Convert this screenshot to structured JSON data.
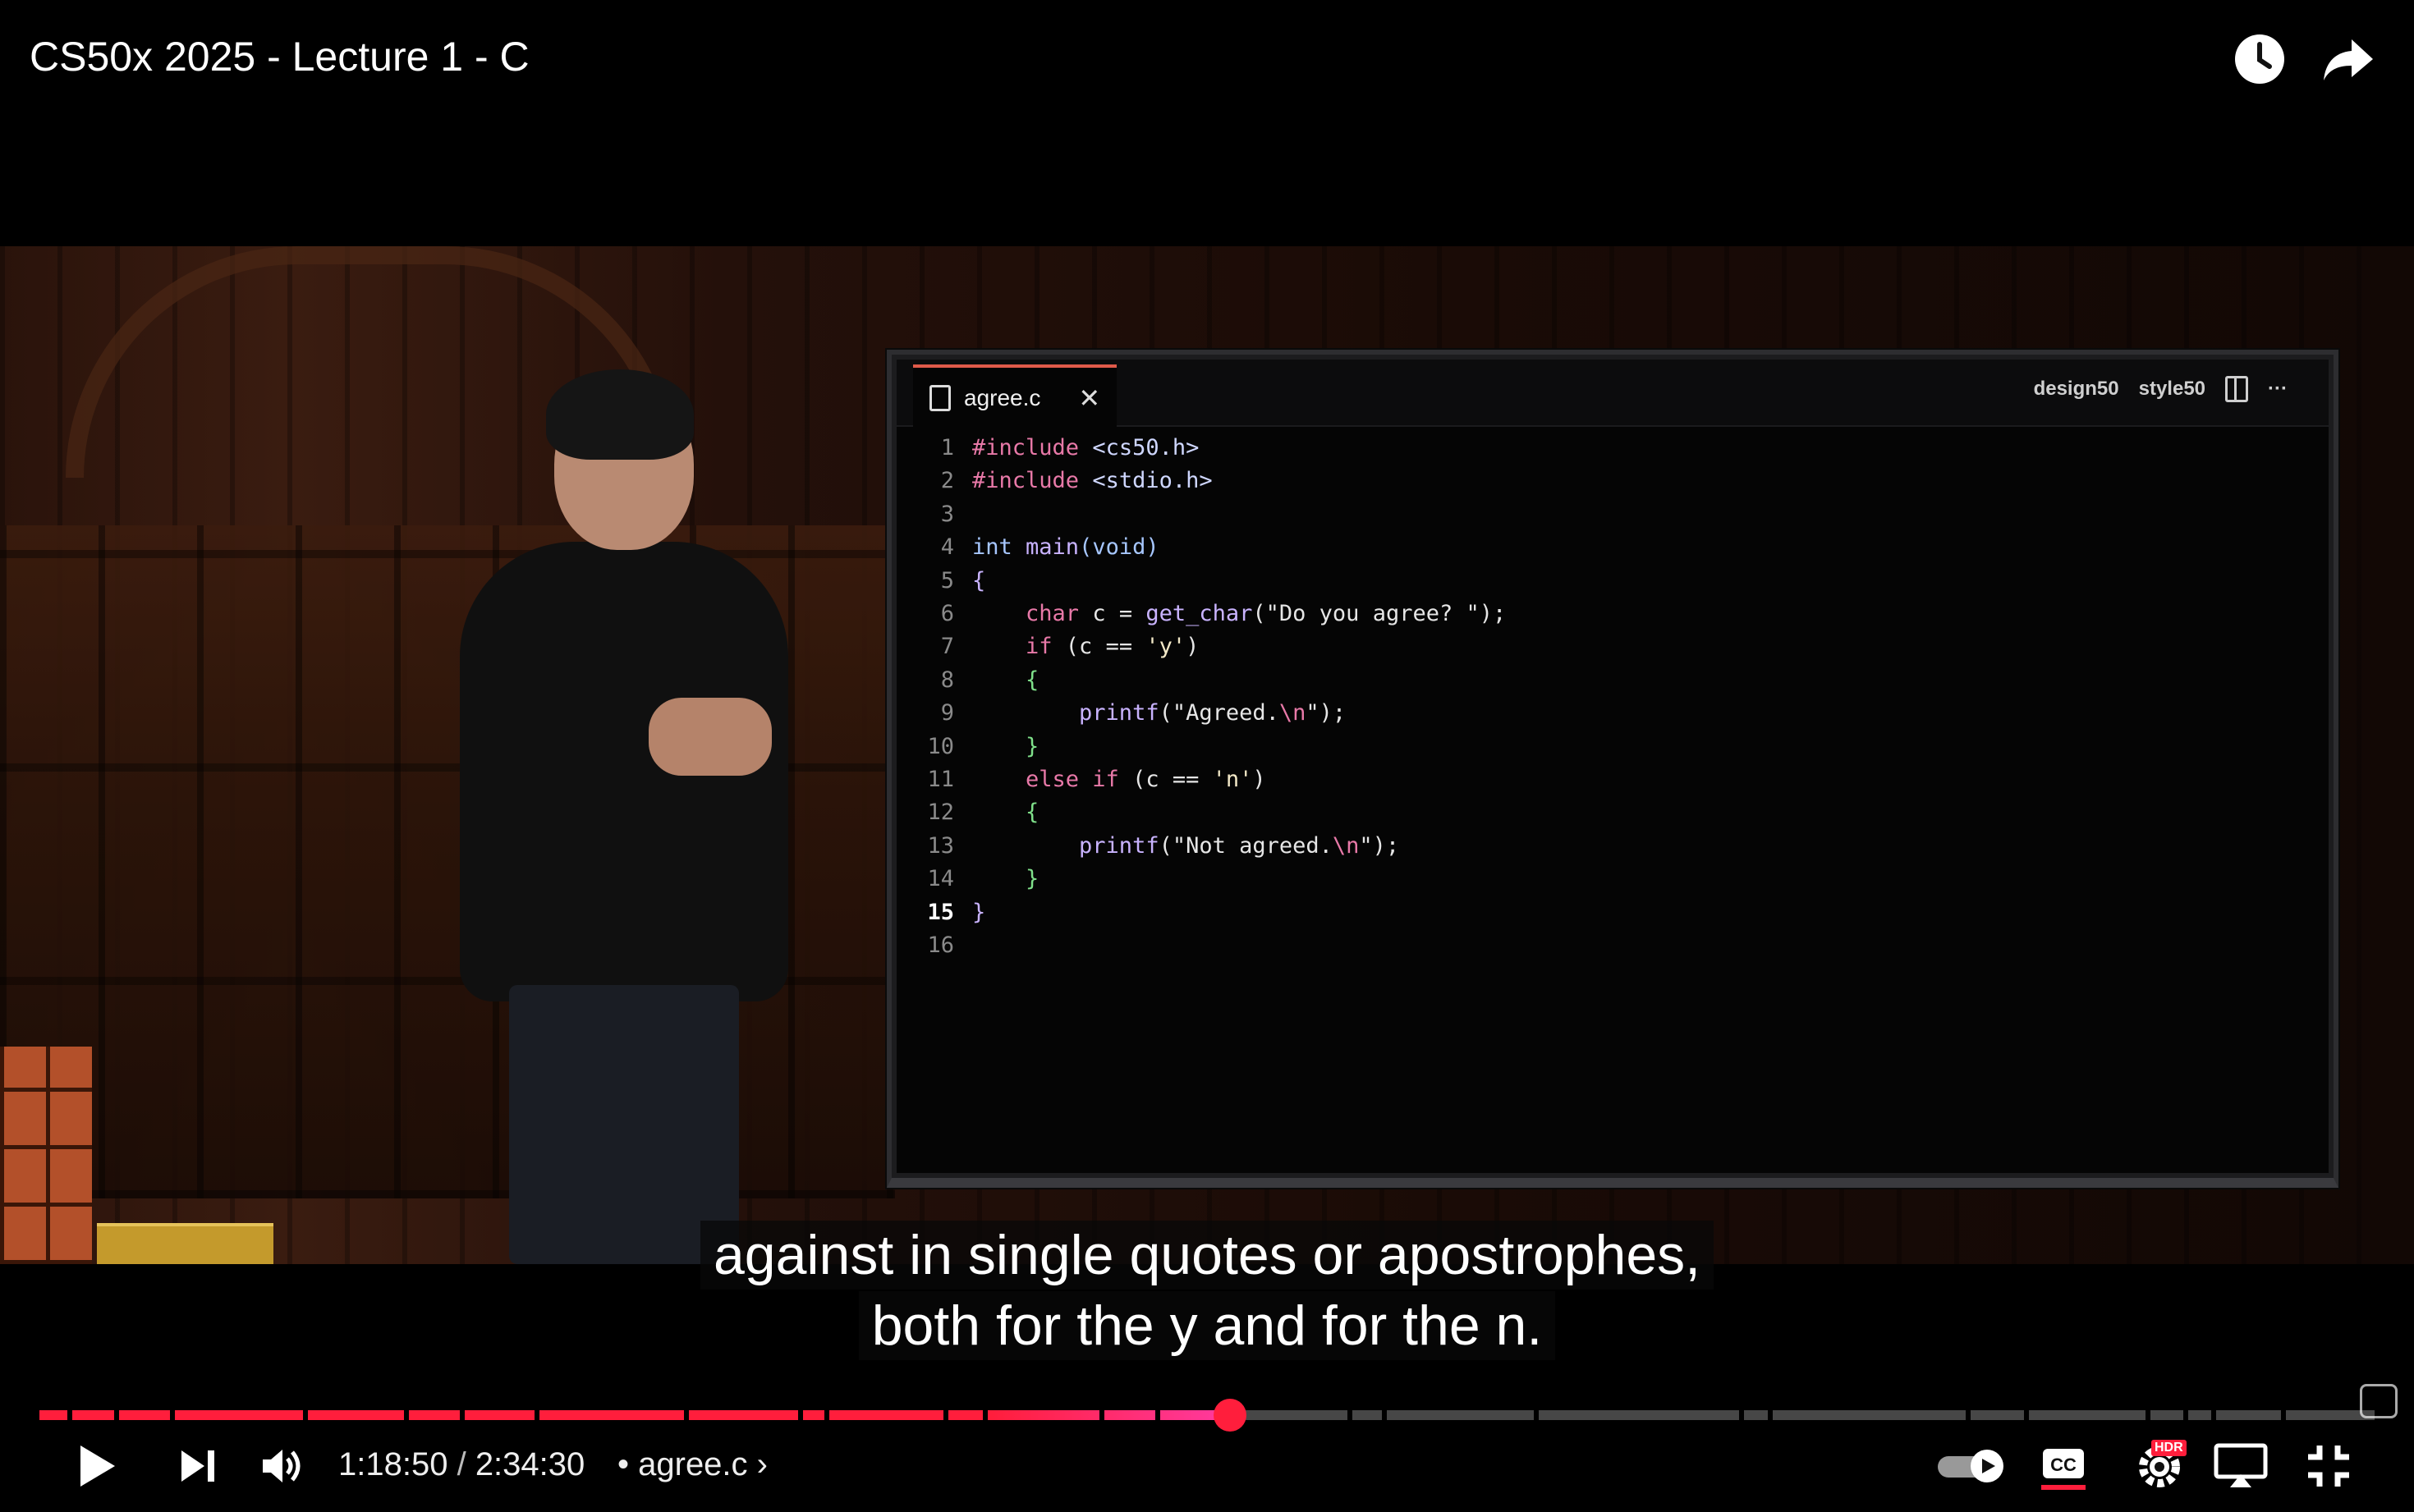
{
  "video": {
    "title": "CS50x 2025 - Lecture 1 - C",
    "editor": {
      "tab_label": "agree.c",
      "tab_close": "✕",
      "actions": [
        "design50",
        "style50"
      ],
      "more": "···",
      "code_lines": [
        {
          "n": "1",
          "parts": [
            {
              "t": "#include ",
              "c": "kw-inc"
            },
            {
              "t": "<cs50.h>",
              "c": "kw-ang"
            }
          ]
        },
        {
          "n": "2",
          "parts": [
            {
              "t": "#include ",
              "c": "kw-inc"
            },
            {
              "t": "<stdio.h>",
              "c": "kw-ang"
            }
          ]
        },
        {
          "n": "3",
          "parts": []
        },
        {
          "n": "4",
          "parts": [
            {
              "t": "int ",
              "c": "kw-type"
            },
            {
              "t": "main",
              "c": "kw-fn"
            },
            {
              "t": "(void)",
              "c": "kw-type"
            }
          ]
        },
        {
          "n": "5",
          "parts": [
            {
              "t": "{",
              "c": "kw-br2"
            }
          ]
        },
        {
          "n": "6",
          "parts": [
            {
              "t": "    char ",
              "c": "kw-ctl"
            },
            {
              "t": "c = ",
              "c": "tx"
            },
            {
              "t": "get_char",
              "c": "kw-fn"
            },
            {
              "t": "(\"Do you agree? \");",
              "c": "tx"
            }
          ]
        },
        {
          "n": "7",
          "parts": [
            {
              "t": "    if ",
              "c": "kw-ctl"
            },
            {
              "t": "(c == ",
              "c": "tx"
            },
            {
              "t": "'y'",
              "c": "kw-str"
            },
            {
              "t": ")",
              "c": "tx"
            }
          ]
        },
        {
          "n": "8",
          "parts": [
            {
              "t": "    {",
              "c": "kw-br"
            }
          ]
        },
        {
          "n": "9",
          "parts": [
            {
              "t": "        printf",
              "c": "kw-fn"
            },
            {
              "t": "(\"Agreed.",
              "c": "tx"
            },
            {
              "t": "\\n",
              "c": "kw-inc"
            },
            {
              "t": "\");",
              "c": "tx"
            }
          ]
        },
        {
          "n": "10",
          "parts": [
            {
              "t": "    }",
              "c": "kw-br"
            }
          ]
        },
        {
          "n": "11",
          "parts": [
            {
              "t": "    else if ",
              "c": "kw-ctl"
            },
            {
              "t": "(c == ",
              "c": "tx"
            },
            {
              "t": "'n'",
              "c": "kw-str"
            },
            {
              "t": ")",
              "c": "tx"
            }
          ]
        },
        {
          "n": "12",
          "parts": [
            {
              "t": "    {",
              "c": "kw-br"
            }
          ]
        },
        {
          "n": "13",
          "parts": [
            {
              "t": "        printf",
              "c": "kw-fn"
            },
            {
              "t": "(\"Not agreed.",
              "c": "tx"
            },
            {
              "t": "\\n",
              "c": "kw-inc"
            },
            {
              "t": "\");",
              "c": "tx"
            }
          ]
        },
        {
          "n": "14",
          "parts": [
            {
              "t": "    }",
              "c": "kw-br"
            }
          ]
        },
        {
          "n": "15",
          "parts": [
            {
              "t": "}",
              "c": "kw-br2"
            }
          ],
          "current": true
        },
        {
          "n": "16",
          "parts": []
        }
      ]
    },
    "captions": {
      "line1": "against in single quotes or apostrophes,",
      "line2": "both for the y and for the n."
    }
  },
  "player": {
    "current_time": "1:18:50",
    "time_separator": " / ",
    "duration": "2:34:30",
    "chapter_separator": " • ",
    "chapter": "agree.c",
    "chapter_chevron": "›",
    "progress_fraction": 0.51,
    "buffered_fraction": 0.51,
    "hdr_badge": "HDR",
    "accent_color": "#ff1e3c",
    "icons": {
      "watch_later": "clock-icon",
      "share": "share-arrow-icon",
      "play": "play-icon",
      "next": "next-icon",
      "volume": "volume-icon",
      "autoplay": "autoplay-toggle-icon",
      "captions": "cc-icon",
      "settings": "gear-hdr-icon",
      "miniplayer": "airplay-icon",
      "exit_fullscreen": "exit-fullscreen-icon"
    }
  }
}
